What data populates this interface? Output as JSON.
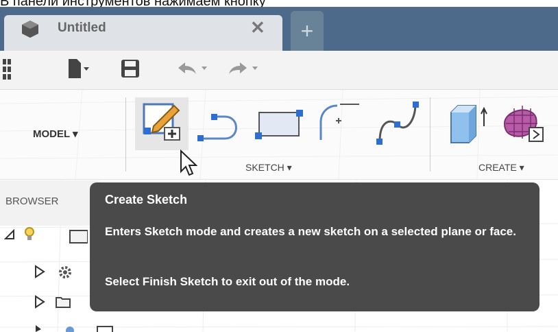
{
  "caption": "В панели инструментов нажимаем кнопку",
  "document_tab": {
    "title": "Untitled",
    "close_glyph": "✕",
    "new_tab_glyph": "+"
  },
  "ribbon": {
    "workspace": "MODEL ▾",
    "groups": [
      {
        "label": "SKETCH ▾"
      },
      {
        "label": "CREATE ▾"
      }
    ]
  },
  "browser": {
    "label": "BROWSER"
  },
  "tooltip": {
    "title": "Create Sketch",
    "body": "Enters Sketch mode and creates a new sketch on a selected plane or face.",
    "hint": "Select Finish Sketch to exit out of the mode."
  },
  "colors": {
    "tabbar": "#4e6a8b",
    "tooltip_bg": "#4a4a4a",
    "accent_blue": "#2c6fd1"
  }
}
